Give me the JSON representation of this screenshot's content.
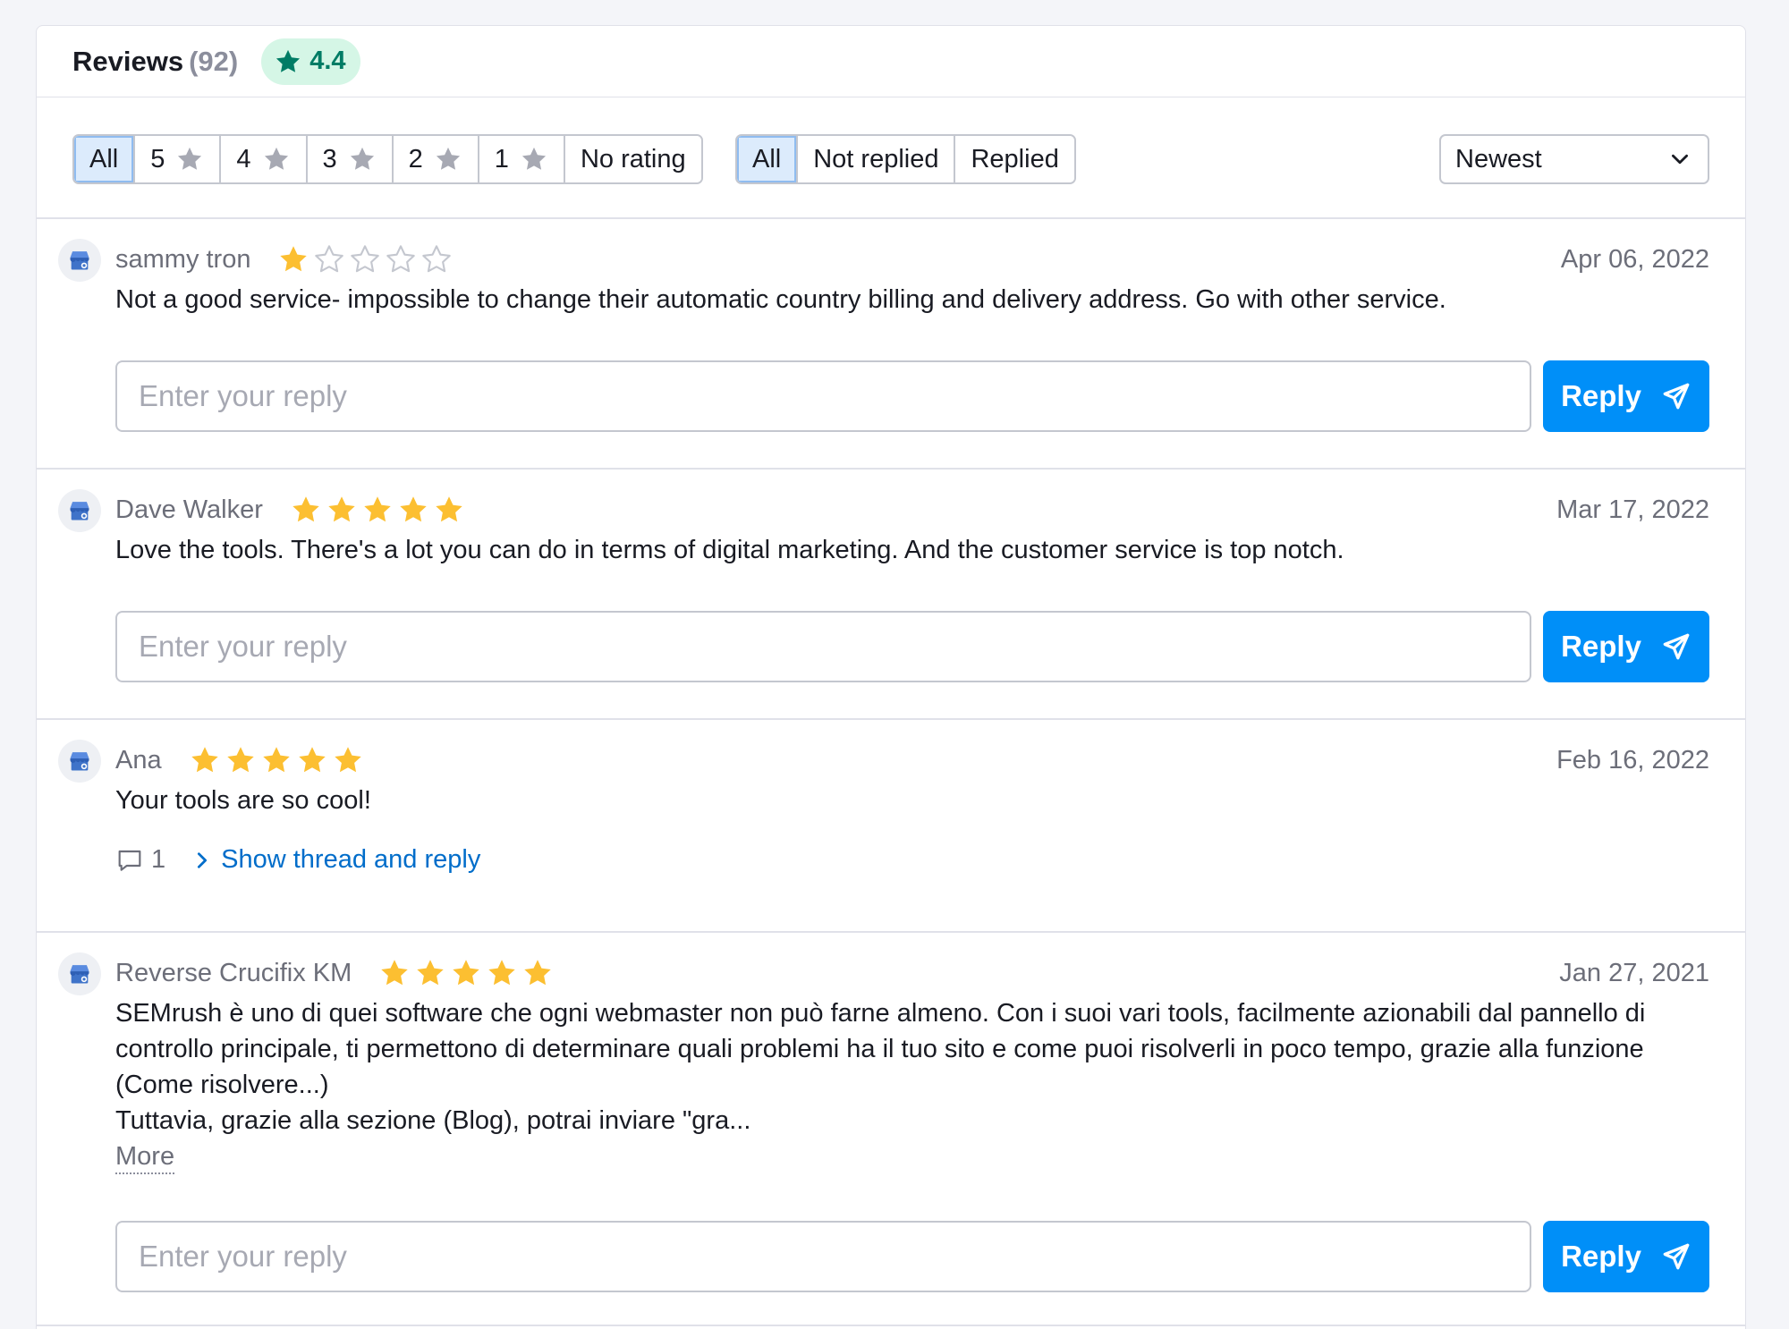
{
  "header": {
    "title": "Reviews",
    "count": "(92)",
    "rating": "4.4"
  },
  "filters": {
    "rating": [
      {
        "label": "All",
        "star": false,
        "active": true
      },
      {
        "label": "5",
        "star": true,
        "active": false
      },
      {
        "label": "4",
        "star": true,
        "active": false
      },
      {
        "label": "3",
        "star": true,
        "active": false
      },
      {
        "label": "2",
        "star": true,
        "active": false
      },
      {
        "label": "1",
        "star": true,
        "active": false
      },
      {
        "label": "No rating",
        "star": false,
        "active": false
      }
    ],
    "reply": [
      {
        "label": "All",
        "active": true
      },
      {
        "label": "Not replied",
        "active": false
      },
      {
        "label": "Replied",
        "active": false
      }
    ],
    "sort": "Newest"
  },
  "reviews": [
    {
      "author": "sammy tron",
      "rating": 1,
      "date": "Apr 06, 2022",
      "text": "Not a good service- impossible to change their automatic country billing and delivery address. Go with other service."
    },
    {
      "author": "Dave Walker",
      "rating": 5,
      "date": "Mar 17, 2022",
      "text": "Love the tools. There's a lot you can do in terms of digital marketing. And the customer service is top notch."
    },
    {
      "author": "Ana",
      "rating": 5,
      "date": "Feb 16, 2022",
      "text": "Your tools are so cool!",
      "replies_count": "1",
      "thread_label": "Show thread and reply"
    },
    {
      "author": "Reverse Crucifix KM",
      "rating": 5,
      "date": "Jan 27, 2021",
      "text_lines": [
        "SEMrush è uno di quei software che ogni webmaster non può farne almeno. Con i suoi vari tools, facilmente azionabili dal pannello di",
        "controllo principale, ti permettono di determinare quali problemi ha il tuo sito e come puoi risolverli in poco tempo, grazie alla funzione",
        "(Come risolvere...)",
        "Tuttavia, grazie alla sezione (Blog), potrai inviare \"gra..."
      ],
      "more_label": "More"
    }
  ],
  "reply_form": {
    "placeholder": "Enter your reply",
    "button_label": "Reply"
  },
  "colors": {
    "accent": "#008ff8",
    "star": "#fcbf31",
    "star_empty": "#c4c7cf",
    "badge_bg": "#d5f6e6",
    "badge_text": "#007c65",
    "link": "#006dca"
  }
}
